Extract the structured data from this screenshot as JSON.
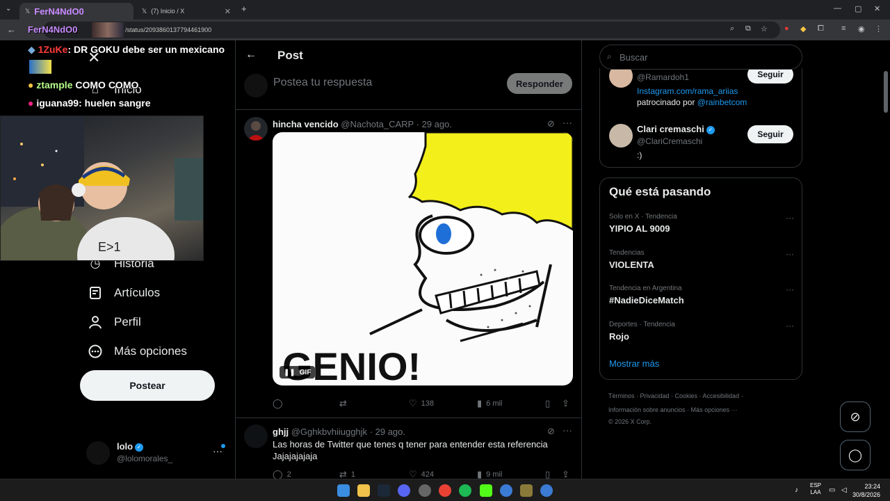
{
  "browser": {
    "tabs": [
      {
        "label": "FerN4NdO0"
      },
      {
        "label": "(7) Inicio / X"
      }
    ],
    "new_tab": "+",
    "url": "/status/2093860137794461900",
    "overlay_name": "FerN4NdO0"
  },
  "chat": [
    {
      "user": "1ZuKe",
      "text": ": DR GOKU debe ser un mexicano"
    },
    {
      "user": "ztample",
      "text": " COMO COMO"
    },
    {
      "user": "iguana99",
      "text": ": huelen sangre"
    }
  ],
  "nav": {
    "items": [
      {
        "label": "Inicio",
        "icon": "home-icon"
      },
      {
        "label": "Historia",
        "icon": "history-icon"
      },
      {
        "label": "Artículos",
        "icon": "articles-icon"
      },
      {
        "label": "Perfil",
        "icon": "profile-icon"
      },
      {
        "label": "Más opciones",
        "icon": "more-icon"
      }
    ],
    "post_button": "Postear",
    "account": {
      "name": "lolo",
      "handle": "@lolomorales_"
    }
  },
  "header": {
    "title": "Post"
  },
  "reply": {
    "placeholder": "Postea tu respuesta",
    "button": "Responder"
  },
  "tweets": [
    {
      "name": "hincha vencido",
      "handle": "@Nachota_CARP",
      "date": "· 29 ago.",
      "media_text": "GENIO!",
      "media_badge": "GIF",
      "likes": "138",
      "views": "6 mil"
    },
    {
      "name": "ghjj",
      "handle": "@Gghkbvhiiugghjk",
      "date": "· 29 ago.",
      "text": "Las horas de Twitter que tenes q tener para entender esta referencia Jajajajajaja",
      "replies": "2",
      "retweets": "1",
      "likes": "424",
      "views": "9 mil"
    }
  ],
  "right": {
    "search_placeholder": "Buscar",
    "users": [
      {
        "handle": "@Ramardoh1",
        "bio_link": "Instagram.com/rama_ariias",
        "bio_prefix": "patrocinado por ",
        "bio_mention": "@rainbetcom",
        "follow": "Seguir"
      },
      {
        "name": "Clari cremaschi",
        "handle": "@ClariCremaschi",
        "bio": ":)",
        "follow": "Seguir"
      }
    ],
    "trends_title": "Qué está pasando",
    "trends": [
      {
        "context": "Solo en X · Tendencia",
        "topic": "YIPIO AL 9009"
      },
      {
        "context": "Tendencias",
        "topic": "VIOLENTA"
      },
      {
        "context": "Tendencia en Argentina",
        "topic": "#NadieDiceMatch"
      },
      {
        "context": "Deportes · Tendencia",
        "topic": "Rojo"
      }
    ],
    "show_more": "Mostrar más",
    "footer": {
      "line1": "Términos · Privacidad · Cookies · Accesibilidad ·",
      "line2": "Información sobre anuncios · Más opciones ···",
      "line3": "© 2026 X Corp."
    }
  },
  "taskbar": {
    "lang_top": "ESP",
    "lang_bottom": "LAA",
    "time": "23:24",
    "date": "30/8/2026"
  },
  "colors": {
    "accent": "#1d9bf0",
    "background": "#000000",
    "gif_yellow": "#f3ef1a",
    "eye_blue": "#1f6fd8"
  }
}
